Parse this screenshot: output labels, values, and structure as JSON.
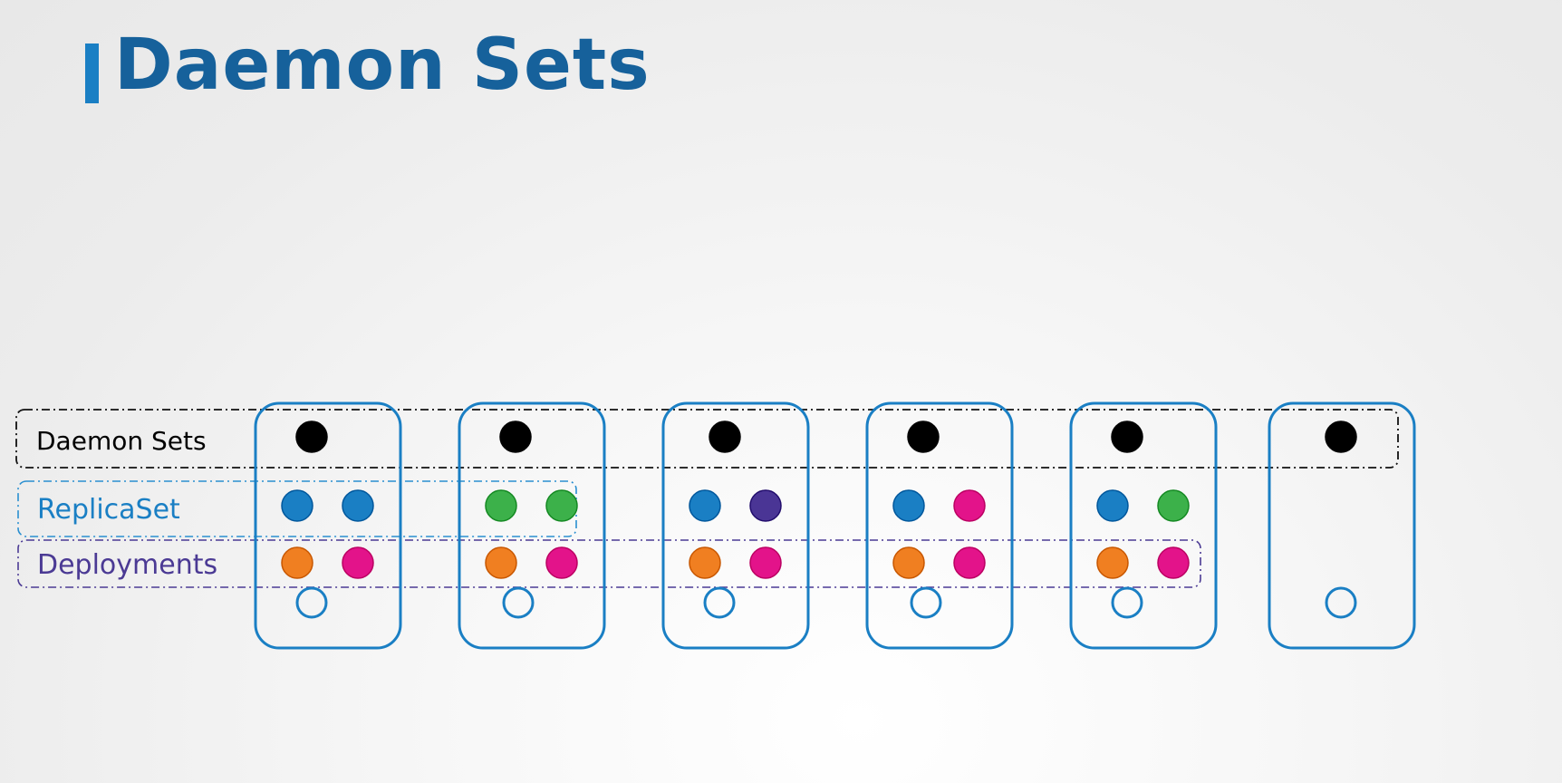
{
  "slide": {
    "title": "Daemon Sets"
  },
  "groups": {
    "daemonset": {
      "label": "Daemon Sets",
      "color": "#000000",
      "border_color": "#111111"
    },
    "replicaset": {
      "label": "ReplicaSet",
      "color": "#1a7fc4",
      "border_color": "#2a8fd0"
    },
    "deployments": {
      "label": "Deployments",
      "color": "#4b3a94",
      "border_color": "#4b3a94"
    }
  },
  "colors": {
    "node_border": "#1a7fc4",
    "blue": "#1a7fc4",
    "green": "#3cb14a",
    "purple": "#4a3595",
    "orange": "#f07f21",
    "pink": "#e3138a",
    "black": "#000000"
  },
  "nodes": [
    {
      "daemon_pod": "black",
      "replicaset_pods": [
        "blue",
        "blue"
      ],
      "deployment_pods": [
        "orange",
        "pink"
      ],
      "empty_slot": true
    },
    {
      "daemon_pod": "black",
      "replicaset_pods": [
        "green",
        "green"
      ],
      "deployment_pods": [
        "orange",
        "pink"
      ],
      "empty_slot": true
    },
    {
      "daemon_pod": "black",
      "replicaset_pods": [
        "blue",
        "purple"
      ],
      "deployment_pods": [
        "orange",
        "pink"
      ],
      "empty_slot": true
    },
    {
      "daemon_pod": "black",
      "replicaset_pods": [
        "blue",
        "pink"
      ],
      "deployment_pods": [
        "orange",
        "pink"
      ],
      "empty_slot": true
    },
    {
      "daemon_pod": "black",
      "replicaset_pods": [
        "blue",
        "green"
      ],
      "deployment_pods": [
        "orange",
        "pink"
      ],
      "empty_slot": true
    },
    {
      "daemon_pod": "black",
      "replicaset_pods": [],
      "deployment_pods": [],
      "empty_slot": true
    }
  ]
}
